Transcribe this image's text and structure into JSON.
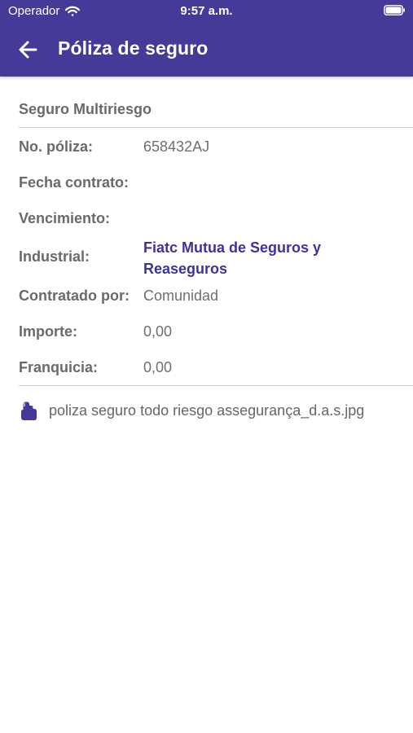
{
  "status_bar": {
    "carrier": "Operador",
    "time": "9:57 a.m."
  },
  "app_bar": {
    "title": "Póliza de seguro",
    "icons": {
      "back": "arrow-left-icon",
      "wifi": "wifi-icon",
      "battery": "battery-icon",
      "attachment": "document-icon"
    }
  },
  "policy": {
    "name": "Seguro Multiriesgo",
    "fields": [
      {
        "label": "No. póliza:",
        "value": "658432AJ"
      },
      {
        "label": "Fecha contrato:",
        "value": ""
      },
      {
        "label": "Vencimiento:",
        "value": ""
      },
      {
        "label": "Industrial:",
        "value": "Fiatc Mutua de Seguros y Reaseguros"
      },
      {
        "label": "Contratado por:",
        "value": "Comunidad"
      },
      {
        "label": "Importe:",
        "value": "0,00"
      },
      {
        "label": "Franquicia:",
        "value": "0,00"
      }
    ]
  },
  "attachment": {
    "file_name": "poliza seguro todo riesgo assegurança_d.a.s.jpg"
  },
  "colors": {
    "header": "#453a97",
    "accent": "#3c3496",
    "divider": "#cfcfcf",
    "text": "#6a6a6a"
  }
}
